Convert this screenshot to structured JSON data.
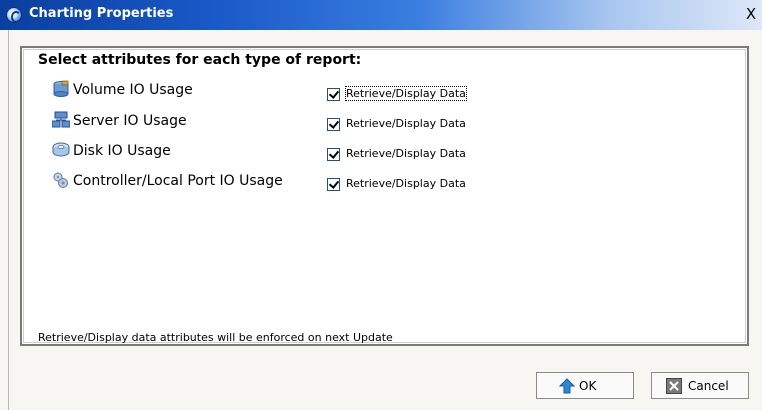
{
  "window": {
    "title": "Charting Properties",
    "close_label": "X"
  },
  "panel": {
    "heading": "Select attributes for each type of report:",
    "rows": [
      {
        "label": "Volume IO Usage",
        "icon": "volume-icon",
        "checkbox_label": "Retrieve/Display Data",
        "checked": true
      },
      {
        "label": "Server IO Usage",
        "icon": "server-icon",
        "checkbox_label": "Retrieve/Display Data",
        "checked": true
      },
      {
        "label": "Disk IO Usage",
        "icon": "disk-icon",
        "checkbox_label": "Retrieve/Display Data",
        "checked": true
      },
      {
        "label": "Controller/Local Port IO Usage",
        "icon": "controller-port-icon",
        "checkbox_label": "Retrieve/Display Data",
        "checked": true
      }
    ],
    "note": "Retrieve/Display data attributes will be enforced on next Update"
  },
  "buttons": {
    "ok_label": "OK",
    "cancel_label": "Cancel"
  }
}
